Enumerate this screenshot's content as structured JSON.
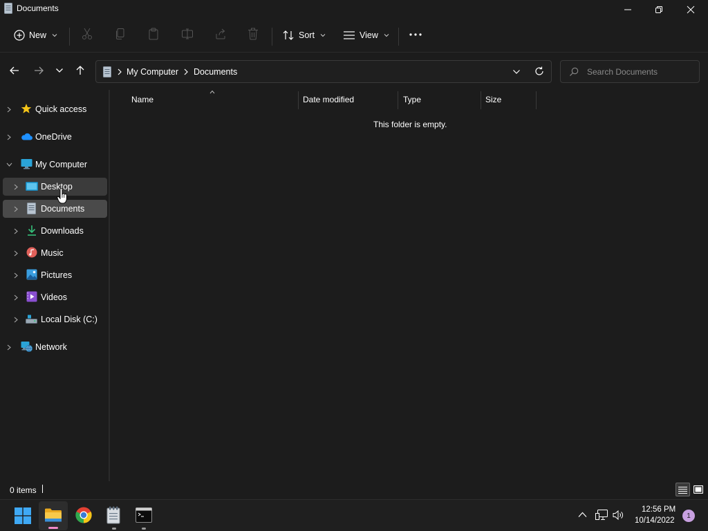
{
  "window": {
    "title": "Documents"
  },
  "commandbar": {
    "new_label": "New",
    "sort_label": "Sort",
    "view_label": "View"
  },
  "address": {
    "crumbs": [
      "My Computer",
      "Documents"
    ]
  },
  "search": {
    "placeholder": "Search Documents"
  },
  "sidebar": {
    "items": [
      {
        "label": "Quick access",
        "icon": "star-icon"
      },
      {
        "label": "OneDrive",
        "icon": "cloud-icon"
      },
      {
        "label": "My Computer",
        "icon": "monitor-icon"
      },
      {
        "label": "Desktop",
        "icon": "desktop-folder-icon"
      },
      {
        "label": "Documents",
        "icon": "documents-icon"
      },
      {
        "label": "Downloads",
        "icon": "download-icon"
      },
      {
        "label": "Music",
        "icon": "music-icon"
      },
      {
        "label": "Pictures",
        "icon": "pictures-icon"
      },
      {
        "label": "Videos",
        "icon": "videos-icon"
      },
      {
        "label": "Local Disk (C:)",
        "icon": "disk-icon"
      },
      {
        "label": "Network",
        "icon": "network-icon"
      }
    ]
  },
  "columns": {
    "name": "Name",
    "date_modified": "Date modified",
    "type": "Type",
    "size": "Size"
  },
  "content": {
    "empty_message": "This folder is empty."
  },
  "status": {
    "items_count": "0 items"
  },
  "taskbar": {
    "apps": [
      "start-icon",
      "file-explorer-icon",
      "chrome-icon",
      "notepad-icon",
      "terminal-icon"
    ],
    "time": "12:56 PM",
    "date": "10/14/2022",
    "notification_count": "1"
  },
  "colors": {
    "background": "#1c1c1c",
    "selection": "#4a4a4a",
    "hover": "#3b3b3b",
    "accent": "#0078d4"
  }
}
